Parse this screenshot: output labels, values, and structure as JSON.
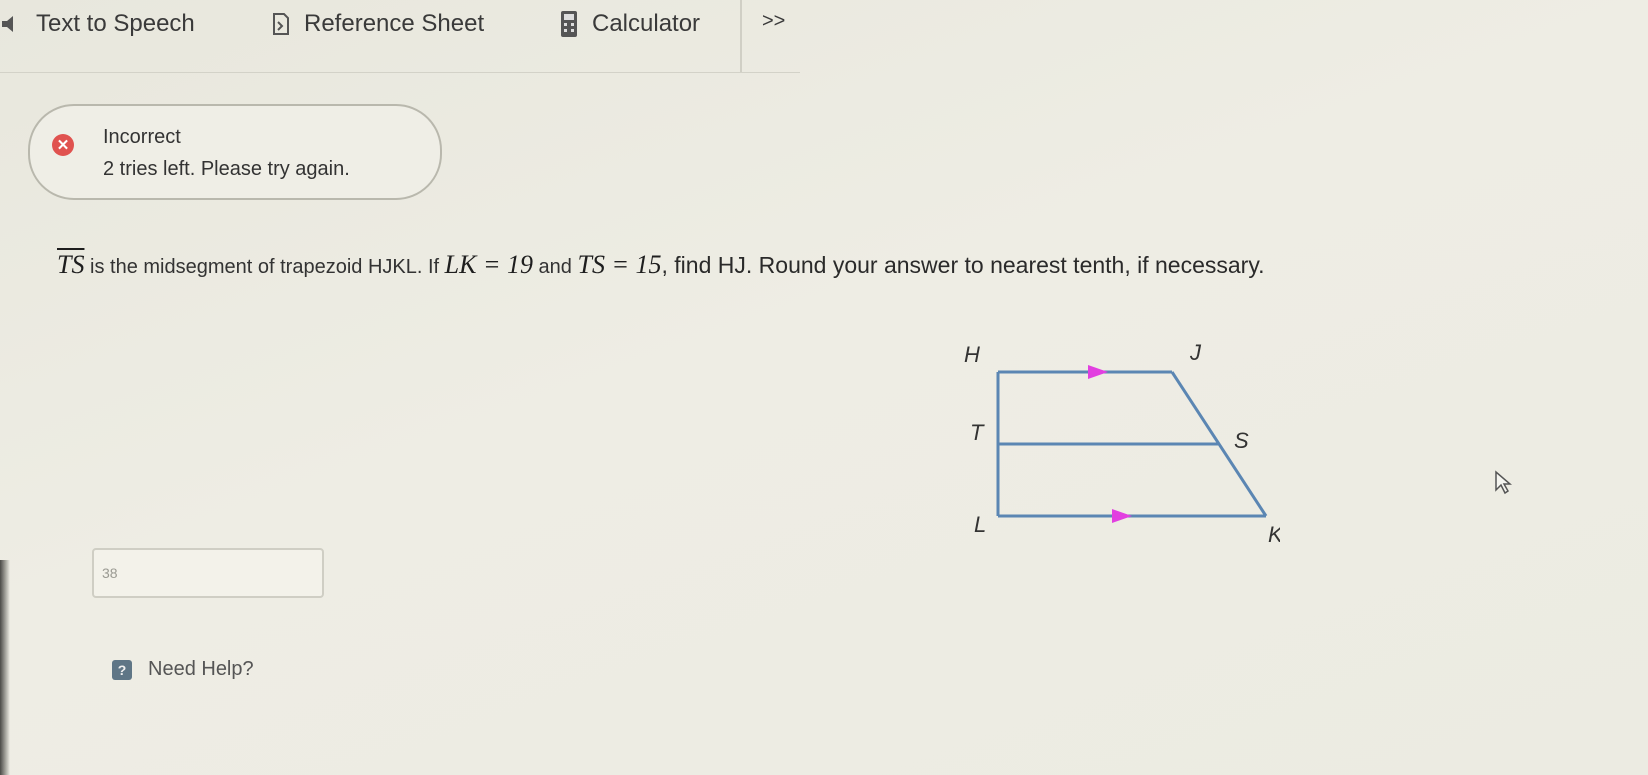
{
  "toolbar": {
    "text_to_speech": "Text to Speech",
    "reference_sheet": "Reference Sheet",
    "calculator": "Calculator",
    "more": ">>"
  },
  "feedback": {
    "status": "Incorrect",
    "message": "2 tries left. Please try again.",
    "status_color": "#e0524f"
  },
  "question": {
    "segment": "TS",
    "part1": " is the midsegment of trapezoid HJKL. If ",
    "given1": "LK = 19",
    "part2": " and ",
    "given2": "TS = 15",
    "part3": ", find ",
    "target": "HJ",
    "part4": ". Round your answer to nearest tenth, if necessary."
  },
  "diagram": {
    "labels": {
      "H": "H",
      "J": "J",
      "T": "T",
      "S": "S",
      "L": "L",
      "K": "K"
    },
    "line_color": "#5b86b3",
    "arrow_color": "#e23fe0"
  },
  "answer": {
    "value": "38",
    "placeholder": ""
  },
  "help": {
    "label": "Need Help?",
    "icon": "?"
  }
}
